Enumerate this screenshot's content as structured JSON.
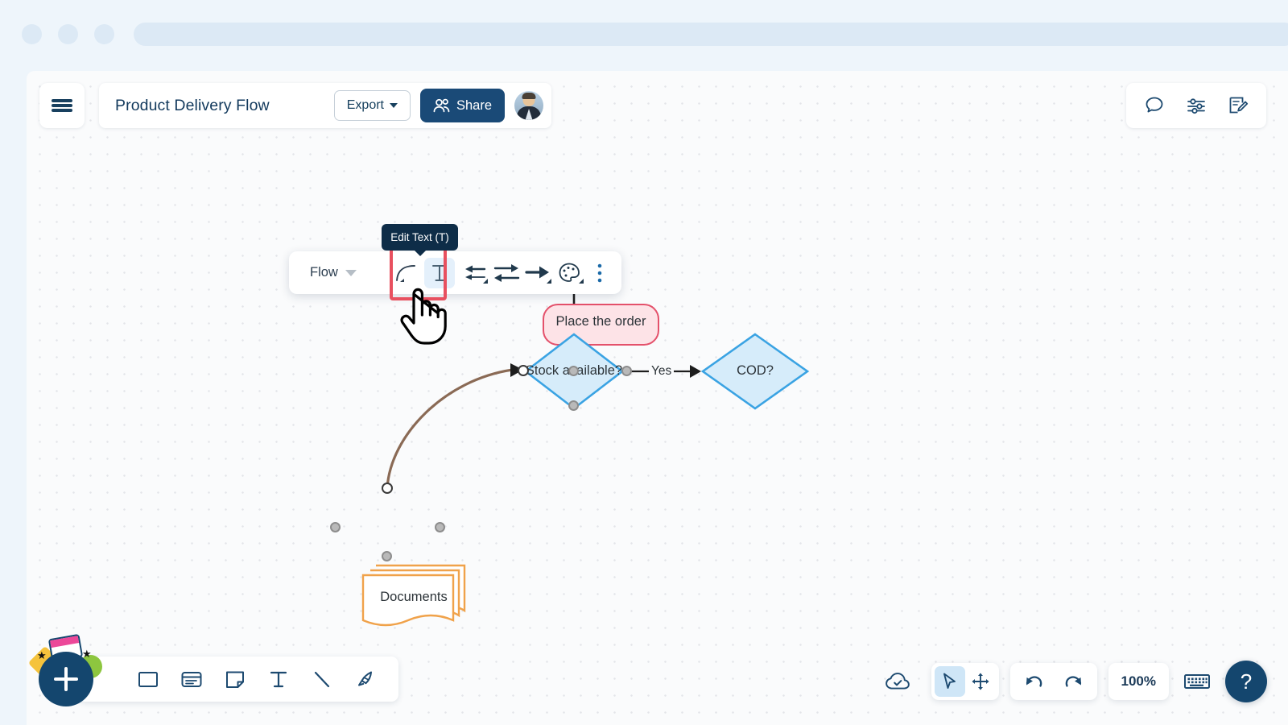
{
  "browser_chrome": {
    "dots": 3
  },
  "header": {
    "menu_icon": "hamburger-icon",
    "doc_title": "Product Delivery Flow",
    "export_label": "Export",
    "share_label": "Share",
    "share_icon": "people-icon",
    "avatar": "user-avatar"
  },
  "top_right": {
    "icons": [
      {
        "name": "comment-icon",
        "label": "Comments"
      },
      {
        "name": "sliders-icon",
        "label": "Settings"
      },
      {
        "name": "note-edit-icon",
        "label": "Notes"
      }
    ]
  },
  "shape_toolbar": {
    "flow_label": "Flow",
    "flow_caret": "chevron-down-icon",
    "items": [
      {
        "name": "curve-line-icon",
        "label": "Curve"
      },
      {
        "name": "edit-text-icon",
        "label": "Edit Text",
        "selected": true
      },
      {
        "name": "arrow-align-left-icon",
        "label": "Line start"
      },
      {
        "name": "arrow-both-icon",
        "label": "Line type"
      },
      {
        "name": "arrow-right-icon",
        "label": "Line end"
      },
      {
        "name": "palette-icon",
        "label": "Color"
      },
      {
        "name": "kebab-menu-icon",
        "label": "More"
      }
    ]
  },
  "tooltip": {
    "text": "Edit Text (T)"
  },
  "cursor": {
    "name": "hand-pointer-cursor"
  },
  "chart_data": {
    "type": "diagram",
    "title": "Product Delivery Flow",
    "nodes": [
      {
        "id": "place",
        "label": "Place the order",
        "shape": "rounded-rect",
        "fill": "#fde3e7",
        "stroke": "#e4516b"
      },
      {
        "id": "stock",
        "label": "Stock available?",
        "shape": "diamond",
        "fill": "#d6ecfa",
        "stroke": "#3aa3e3"
      },
      {
        "id": "cod",
        "label": "COD?",
        "shape": "diamond",
        "fill": "#d6ecfa",
        "stroke": "#3aa3e3"
      },
      {
        "id": "docs",
        "label": "Documents",
        "shape": "multi-document",
        "fill": "#ffffff",
        "stroke": "#f0a24a"
      }
    ],
    "edges": [
      {
        "from": "place",
        "to": "stock",
        "label": "",
        "style": "straight",
        "color": "#1d1d1d"
      },
      {
        "from": "stock",
        "to": "cod",
        "label": "Yes",
        "style": "straight",
        "color": "#1d1d1d"
      },
      {
        "from": "docs",
        "to": "stock",
        "label": "",
        "style": "curved",
        "color": "#8a6a55"
      }
    ]
  },
  "bottom_left_toolbar": {
    "fab": {
      "name": "add-button",
      "glyph": "+"
    },
    "tools": [
      {
        "name": "rectangle-tool-icon",
        "label": "Shape"
      },
      {
        "name": "card-tool-icon",
        "label": "Card"
      },
      {
        "name": "sticky-note-tool-icon",
        "label": "Note"
      },
      {
        "name": "text-tool-icon",
        "label": "Text"
      },
      {
        "name": "line-tool-icon",
        "label": "Line"
      },
      {
        "name": "pen-tool-icon",
        "label": "Draw"
      }
    ]
  },
  "bottom_right": {
    "save_status_icon": "cloud-check-icon",
    "select_icon": "cursor-arrow-icon",
    "pan_icon": "move-icon",
    "undo_icon": "undo-icon",
    "redo_icon": "redo-icon",
    "zoom_level": "100%",
    "keyboard_icon": "keyboard-icon",
    "help_label": "?"
  },
  "colors": {
    "brand_navy": "#14466e",
    "diamond_fill": "#d6ecfa",
    "diamond_stroke": "#3aa3e3",
    "pink_fill": "#fde3e7",
    "pink_stroke": "#e4516b",
    "doc_stroke": "#f0a24a",
    "curve_edge": "#8a6a55",
    "highlight": "#e8505f"
  }
}
